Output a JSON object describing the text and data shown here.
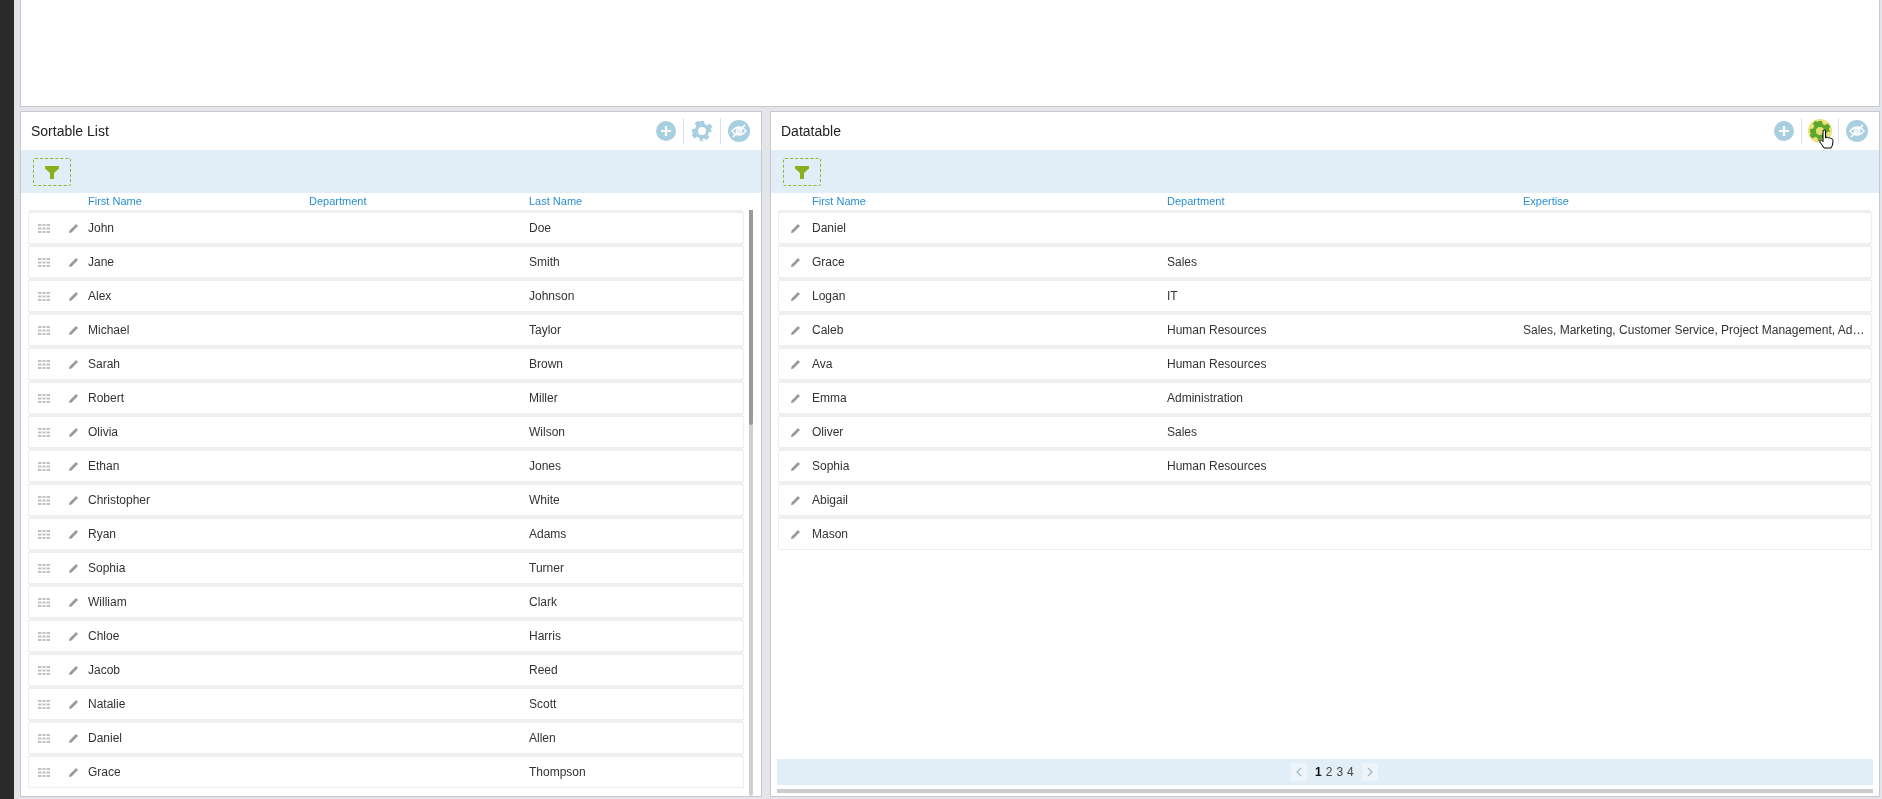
{
  "panels": [
    {
      "title": "Sortable List",
      "kind": "sortable",
      "toolbar": [
        {
          "kind": "add",
          "hovered": false
        },
        {
          "kind": "settings",
          "hovered": false
        },
        {
          "kind": "hide",
          "hovered": false
        }
      ],
      "columns": [
        "First Name",
        "Department",
        "Last Name"
      ],
      "rows": [
        {
          "cells": [
            "John",
            null,
            "Doe"
          ]
        },
        {
          "cells": [
            "Jane",
            null,
            "Smith"
          ]
        },
        {
          "cells": [
            "Alex",
            null,
            "Johnson"
          ]
        },
        {
          "cells": [
            "Michael",
            null,
            "Taylor"
          ]
        },
        {
          "cells": [
            "Sarah",
            null,
            "Brown"
          ]
        },
        {
          "cells": [
            "Robert",
            null,
            "Miller"
          ]
        },
        {
          "cells": [
            "Olivia",
            null,
            "Wilson"
          ]
        },
        {
          "cells": [
            "Ethan",
            null,
            "Jones"
          ]
        },
        {
          "cells": [
            "Christopher",
            null,
            "White"
          ]
        },
        {
          "cells": [
            "Ryan",
            null,
            "Adams"
          ]
        },
        {
          "cells": [
            "Sophia",
            null,
            "Turner"
          ]
        },
        {
          "cells": [
            "William",
            null,
            "Clark"
          ]
        },
        {
          "cells": [
            "Chloe",
            null,
            "Harris"
          ]
        },
        {
          "cells": [
            "Jacob",
            null,
            "Reed"
          ]
        },
        {
          "cells": [
            "Natalie",
            null,
            "Scott"
          ]
        },
        {
          "cells": [
            "Daniel",
            null,
            "Allen"
          ]
        },
        {
          "cells": [
            "Grace",
            null,
            "Thompson"
          ]
        }
      ]
    },
    {
      "title": "Datatable",
      "kind": "datatable",
      "toolbar": [
        {
          "kind": "add",
          "hovered": false
        },
        {
          "kind": "settings",
          "hovered": true
        },
        {
          "kind": "hide",
          "hovered": false
        }
      ],
      "columns": [
        "First Name",
        "Department",
        "Expertise"
      ],
      "rows": [
        {
          "cells": [
            "Daniel",
            null,
            null
          ]
        },
        {
          "cells": [
            "Grace",
            "Sales",
            null
          ]
        },
        {
          "cells": [
            "Logan",
            "IT",
            null
          ]
        },
        {
          "cells": [
            "Caleb",
            "Human Resources",
            "Sales, Marketing, Customer Service, Project Management, Ad…"
          ]
        },
        {
          "cells": [
            "Ava",
            "Human Resources",
            null
          ]
        },
        {
          "cells": [
            "Emma",
            "Administration",
            null
          ]
        },
        {
          "cells": [
            "Oliver",
            "Sales",
            null
          ]
        },
        {
          "cells": [
            "Sophia",
            "Human Resources",
            null
          ]
        },
        {
          "cells": [
            "Abigail",
            null,
            null
          ]
        },
        {
          "cells": [
            "Mason",
            null,
            null
          ]
        }
      ],
      "pagination": {
        "pages": [
          {
            "label": "1",
            "selected": true
          },
          {
            "label": "2",
            "selected": false
          },
          {
            "label": "3",
            "selected": false
          },
          {
            "label": "4",
            "selected": false
          }
        ]
      }
    }
  ]
}
